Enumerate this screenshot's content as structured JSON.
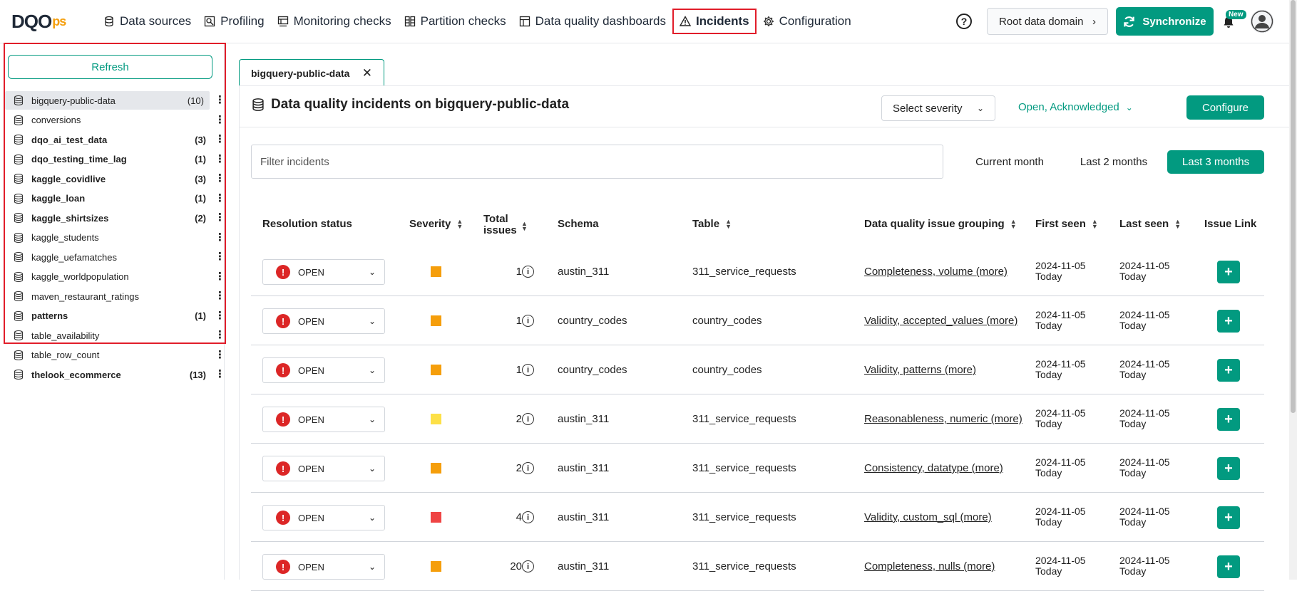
{
  "header": {
    "logo_main": "DQO",
    "logo_suffix": "ps",
    "nav": [
      {
        "label": "Data sources",
        "icon": "database-icon"
      },
      {
        "label": "Profiling",
        "icon": "profiling-icon"
      },
      {
        "label": "Monitoring checks",
        "icon": "monitoring-icon"
      },
      {
        "label": "Partition checks",
        "icon": "partition-icon"
      },
      {
        "label": "Data quality dashboards",
        "icon": "dashboard-icon"
      },
      {
        "label": "Incidents",
        "icon": "warning-icon",
        "active": true
      },
      {
        "label": "Configuration",
        "icon": "gear-icon"
      }
    ],
    "help": "?",
    "domain_label": "Root data domain",
    "sync_label": "Synchronize",
    "new_badge": "New"
  },
  "sidebar": {
    "refresh_label": "Refresh",
    "items": [
      {
        "label": "bigquery-public-data",
        "count": "(10)",
        "bold": false,
        "selected": true
      },
      {
        "label": "conversions",
        "count": "",
        "bold": false
      },
      {
        "label": "dqo_ai_test_data",
        "count": "(3)",
        "bold": true
      },
      {
        "label": "dqo_testing_time_lag",
        "count": "(1)",
        "bold": true
      },
      {
        "label": "kaggle_covidlive",
        "count": "(3)",
        "bold": true
      },
      {
        "label": "kaggle_loan",
        "count": "(1)",
        "bold": true
      },
      {
        "label": "kaggle_shirtsizes",
        "count": "(2)",
        "bold": true
      },
      {
        "label": "kaggle_students",
        "count": "",
        "bold": false
      },
      {
        "label": "kaggle_uefamatches",
        "count": "",
        "bold": false
      },
      {
        "label": "kaggle_worldpopulation",
        "count": "",
        "bold": false
      },
      {
        "label": "maven_restaurant_ratings",
        "count": "",
        "bold": false
      },
      {
        "label": "patterns",
        "count": "(1)",
        "bold": true
      },
      {
        "label": "table_availability",
        "count": "",
        "bold": false
      },
      {
        "label": "table_row_count",
        "count": "",
        "bold": false
      },
      {
        "label": "thelook_ecommerce",
        "count": "(13)",
        "bold": true
      }
    ]
  },
  "main": {
    "tab_label": "bigquery-public-data",
    "title": "Data quality incidents on bigquery-public-data",
    "severity_placeholder": "Select severity",
    "status_filter": "Open, Acknowledged",
    "configure_label": "Configure",
    "filter_placeholder": "Filter incidents",
    "ranges": [
      "Current month",
      "Last 2 months",
      "Last 3 months"
    ],
    "active_range": "Last 3 months",
    "columns": {
      "status": "Resolution status",
      "severity": "Severity",
      "total_issues_1": "Total",
      "total_issues_2": "issues",
      "schema": "Schema",
      "table": "Table",
      "grouping": "Data quality issue grouping",
      "first_seen": "First seen",
      "last_seen": "Last seen",
      "issue_link": "Issue Link"
    },
    "rows": [
      {
        "status": "OPEN",
        "severity_color": "#f59e0b",
        "issues": "1",
        "schema": "austin_311",
        "table": "311_service_requests",
        "grouping": "Completeness, volume (more)",
        "first_date": "2024-11-05",
        "first_rel": "Today",
        "last_date": "2024-11-05",
        "last_rel": "Today"
      },
      {
        "status": "OPEN",
        "severity_color": "#f59e0b",
        "issues": "1",
        "schema": "country_codes",
        "table": "country_codes",
        "grouping": "Validity, accepted_values (more)",
        "first_date": "2024-11-05",
        "first_rel": "Today",
        "last_date": "2024-11-05",
        "last_rel": "Today"
      },
      {
        "status": "OPEN",
        "severity_color": "#f59e0b",
        "issues": "1",
        "schema": "country_codes",
        "table": "country_codes",
        "grouping": "Validity, patterns (more)",
        "first_date": "2024-11-05",
        "first_rel": "Today",
        "last_date": "2024-11-05",
        "last_rel": "Today"
      },
      {
        "status": "OPEN",
        "severity_color": "#fde047",
        "issues": "2",
        "schema": "austin_311",
        "table": "311_service_requests",
        "grouping": "Reasonableness, numeric (more)",
        "first_date": "2024-11-05",
        "first_rel": "Today",
        "last_date": "2024-11-05",
        "last_rel": "Today"
      },
      {
        "status": "OPEN",
        "severity_color": "#f59e0b",
        "issues": "2",
        "schema": "austin_311",
        "table": "311_service_requests",
        "grouping": "Consistency, datatype (more)",
        "first_date": "2024-11-05",
        "first_rel": "Today",
        "last_date": "2024-11-05",
        "last_rel": "Today"
      },
      {
        "status": "OPEN",
        "severity_color": "#ef4444",
        "issues": "4",
        "schema": "austin_311",
        "table": "311_service_requests",
        "grouping": "Validity, custom_sql (more)",
        "first_date": "2024-11-05",
        "first_rel": "Today",
        "last_date": "2024-11-05",
        "last_rel": "Today"
      },
      {
        "status": "OPEN",
        "severity_color": "#f59e0b",
        "issues": "20",
        "schema": "austin_311",
        "table": "311_service_requests",
        "grouping": "Completeness, nulls (more)",
        "first_date": "2024-11-05",
        "first_rel": "Today",
        "last_date": "2024-11-05",
        "last_rel": "Today"
      }
    ]
  }
}
